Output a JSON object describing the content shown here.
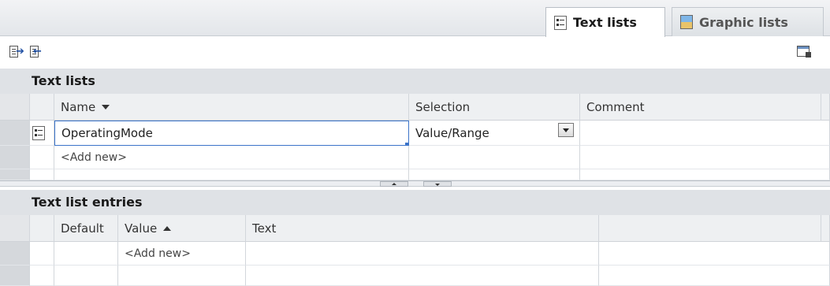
{
  "tabs": [
    {
      "label": "Text lists",
      "icon": "text-list-icon",
      "active": true
    },
    {
      "label": "Graphic lists",
      "icon": "graphic-list-icon",
      "active": false
    }
  ],
  "text_lists": {
    "title": "Text lists",
    "columns": {
      "name": "Name",
      "selection": "Selection",
      "comment": "Comment"
    },
    "rows": [
      {
        "name": "OperatingMode",
        "selection": "Value/Range",
        "comment": ""
      }
    ],
    "add_new": "<Add new>"
  },
  "entries": {
    "title": "Text list entries",
    "columns": {
      "default": "Default",
      "value": "Value",
      "text": "Text"
    },
    "add_new": "<Add new>"
  }
}
